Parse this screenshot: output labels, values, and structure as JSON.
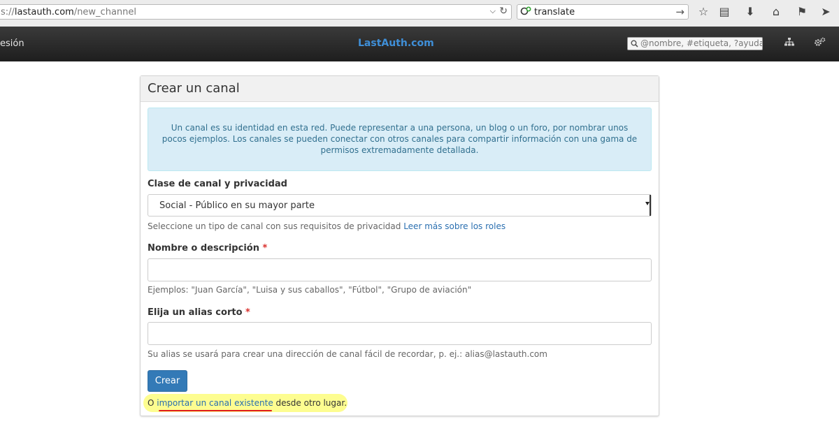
{
  "browser": {
    "url_prefix": "s://",
    "url_host": "lastauth.com",
    "url_path": "/new_channel",
    "search_value": "translate"
  },
  "navbar": {
    "left_text": "esión",
    "brand": "LastAuth.com",
    "search_placeholder": "@nombre, #etiqueta, ?ayuda"
  },
  "panel": {
    "title": "Crear un canal",
    "intro": "Un canal es su identidad en esta red. Puede representar a una persona, un blog o un foro, por nombrar unos pocos ejemplos. Los canales se pueden conectar con otros canales para compartir información con una gama de permisos extremadamente detallada.",
    "privacy_label": "Clase de canal y privacidad",
    "privacy_selected": "Social - Público en su mayor parte",
    "privacy_help": "Seleccione un tipo de canal con sus requisitos de privacidad",
    "privacy_help_link": "Leer más sobre los roles",
    "name_label": "Nombre o descripción",
    "required_mark": "*",
    "name_value": "",
    "name_help": "Ejemplos: \"Juan García\", \"Luisa y sus caballos\", \"Fútbol\", \"Grupo de aviación\"",
    "alias_label": "Elija un alias corto",
    "alias_value": "",
    "alias_help": "Su alias se usará para crear una dirección de canal fácil de recordar, p. ej.: alias@lastauth.com",
    "submit": "Crear",
    "import_prefix": "O ",
    "import_link": "importar un canal existente",
    "import_suffix": " desde otro lugar."
  },
  "colors": {
    "brand": "#3f8fd8",
    "primary_button": "#337ab7",
    "alert_bg": "#d9edf7",
    "highlight": "#fdfd7c",
    "annotation_underline": "#e01b1b"
  }
}
